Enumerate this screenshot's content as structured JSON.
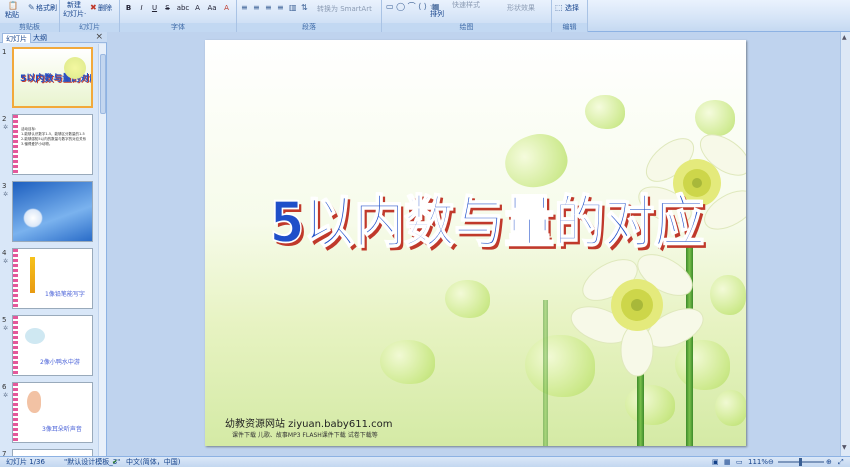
{
  "ribbon": {
    "clipboard": {
      "paste": "粘贴",
      "format_painter": "格式刷",
      "label": "剪贴板"
    },
    "slides": {
      "new_slide_l1": "新建",
      "new_slide_l2": "幻灯片·",
      "delete": "删除",
      "label": "幻灯片"
    },
    "font": {
      "label": "字体",
      "buttons": [
        "B",
        "I",
        "U",
        "S",
        "abc",
        "A",
        "Aa",
        "A"
      ]
    },
    "paragraph": {
      "label": "段落",
      "smartart": "转换为 SmartArt"
    },
    "drawing": {
      "label": "绘图",
      "arrange": "排列",
      "quick_styles": "快速样式",
      "shape_effects": "形状效果"
    },
    "editing": {
      "label": "编辑",
      "select": "选择"
    }
  },
  "panel": {
    "tabs": [
      "幻灯片",
      "大纲"
    ],
    "close": "×",
    "slides": [
      {
        "num": "1",
        "title": "5以内数与量的对应"
      },
      {
        "num": "2",
        "lines": [
          "活动目标:",
          "1.能够认识数字1-5，能够区分数量的1-5",
          "2.能够感知5以内的数量与数字的对应关系",
          "3.懂得爱护小动物。"
        ]
      },
      {
        "num": "3"
      },
      {
        "num": "4",
        "caption": "1像铅笔能写字"
      },
      {
        "num": "5",
        "caption": "2像小鸭水中游"
      },
      {
        "num": "6",
        "caption": "3像耳朵听声音"
      },
      {
        "num": "7"
      }
    ]
  },
  "slide": {
    "title": "5以内数与量的对应",
    "site": "幼教资源网站  ziyuan.baby611.com",
    "subtitle": "课件下载   儿歌、故事MP3   FLASH课件下载   试卷下载等"
  },
  "status": {
    "slide_indicator": "幻灯片 1/36",
    "theme": "\"默认设计模板_3\"",
    "language": "中文(简体，中国)",
    "zoom": "111%"
  },
  "colors": {
    "title": "#1f4fc9",
    "title_shadow": "#c0392b",
    "selected_thumb": "#f2a93b"
  }
}
